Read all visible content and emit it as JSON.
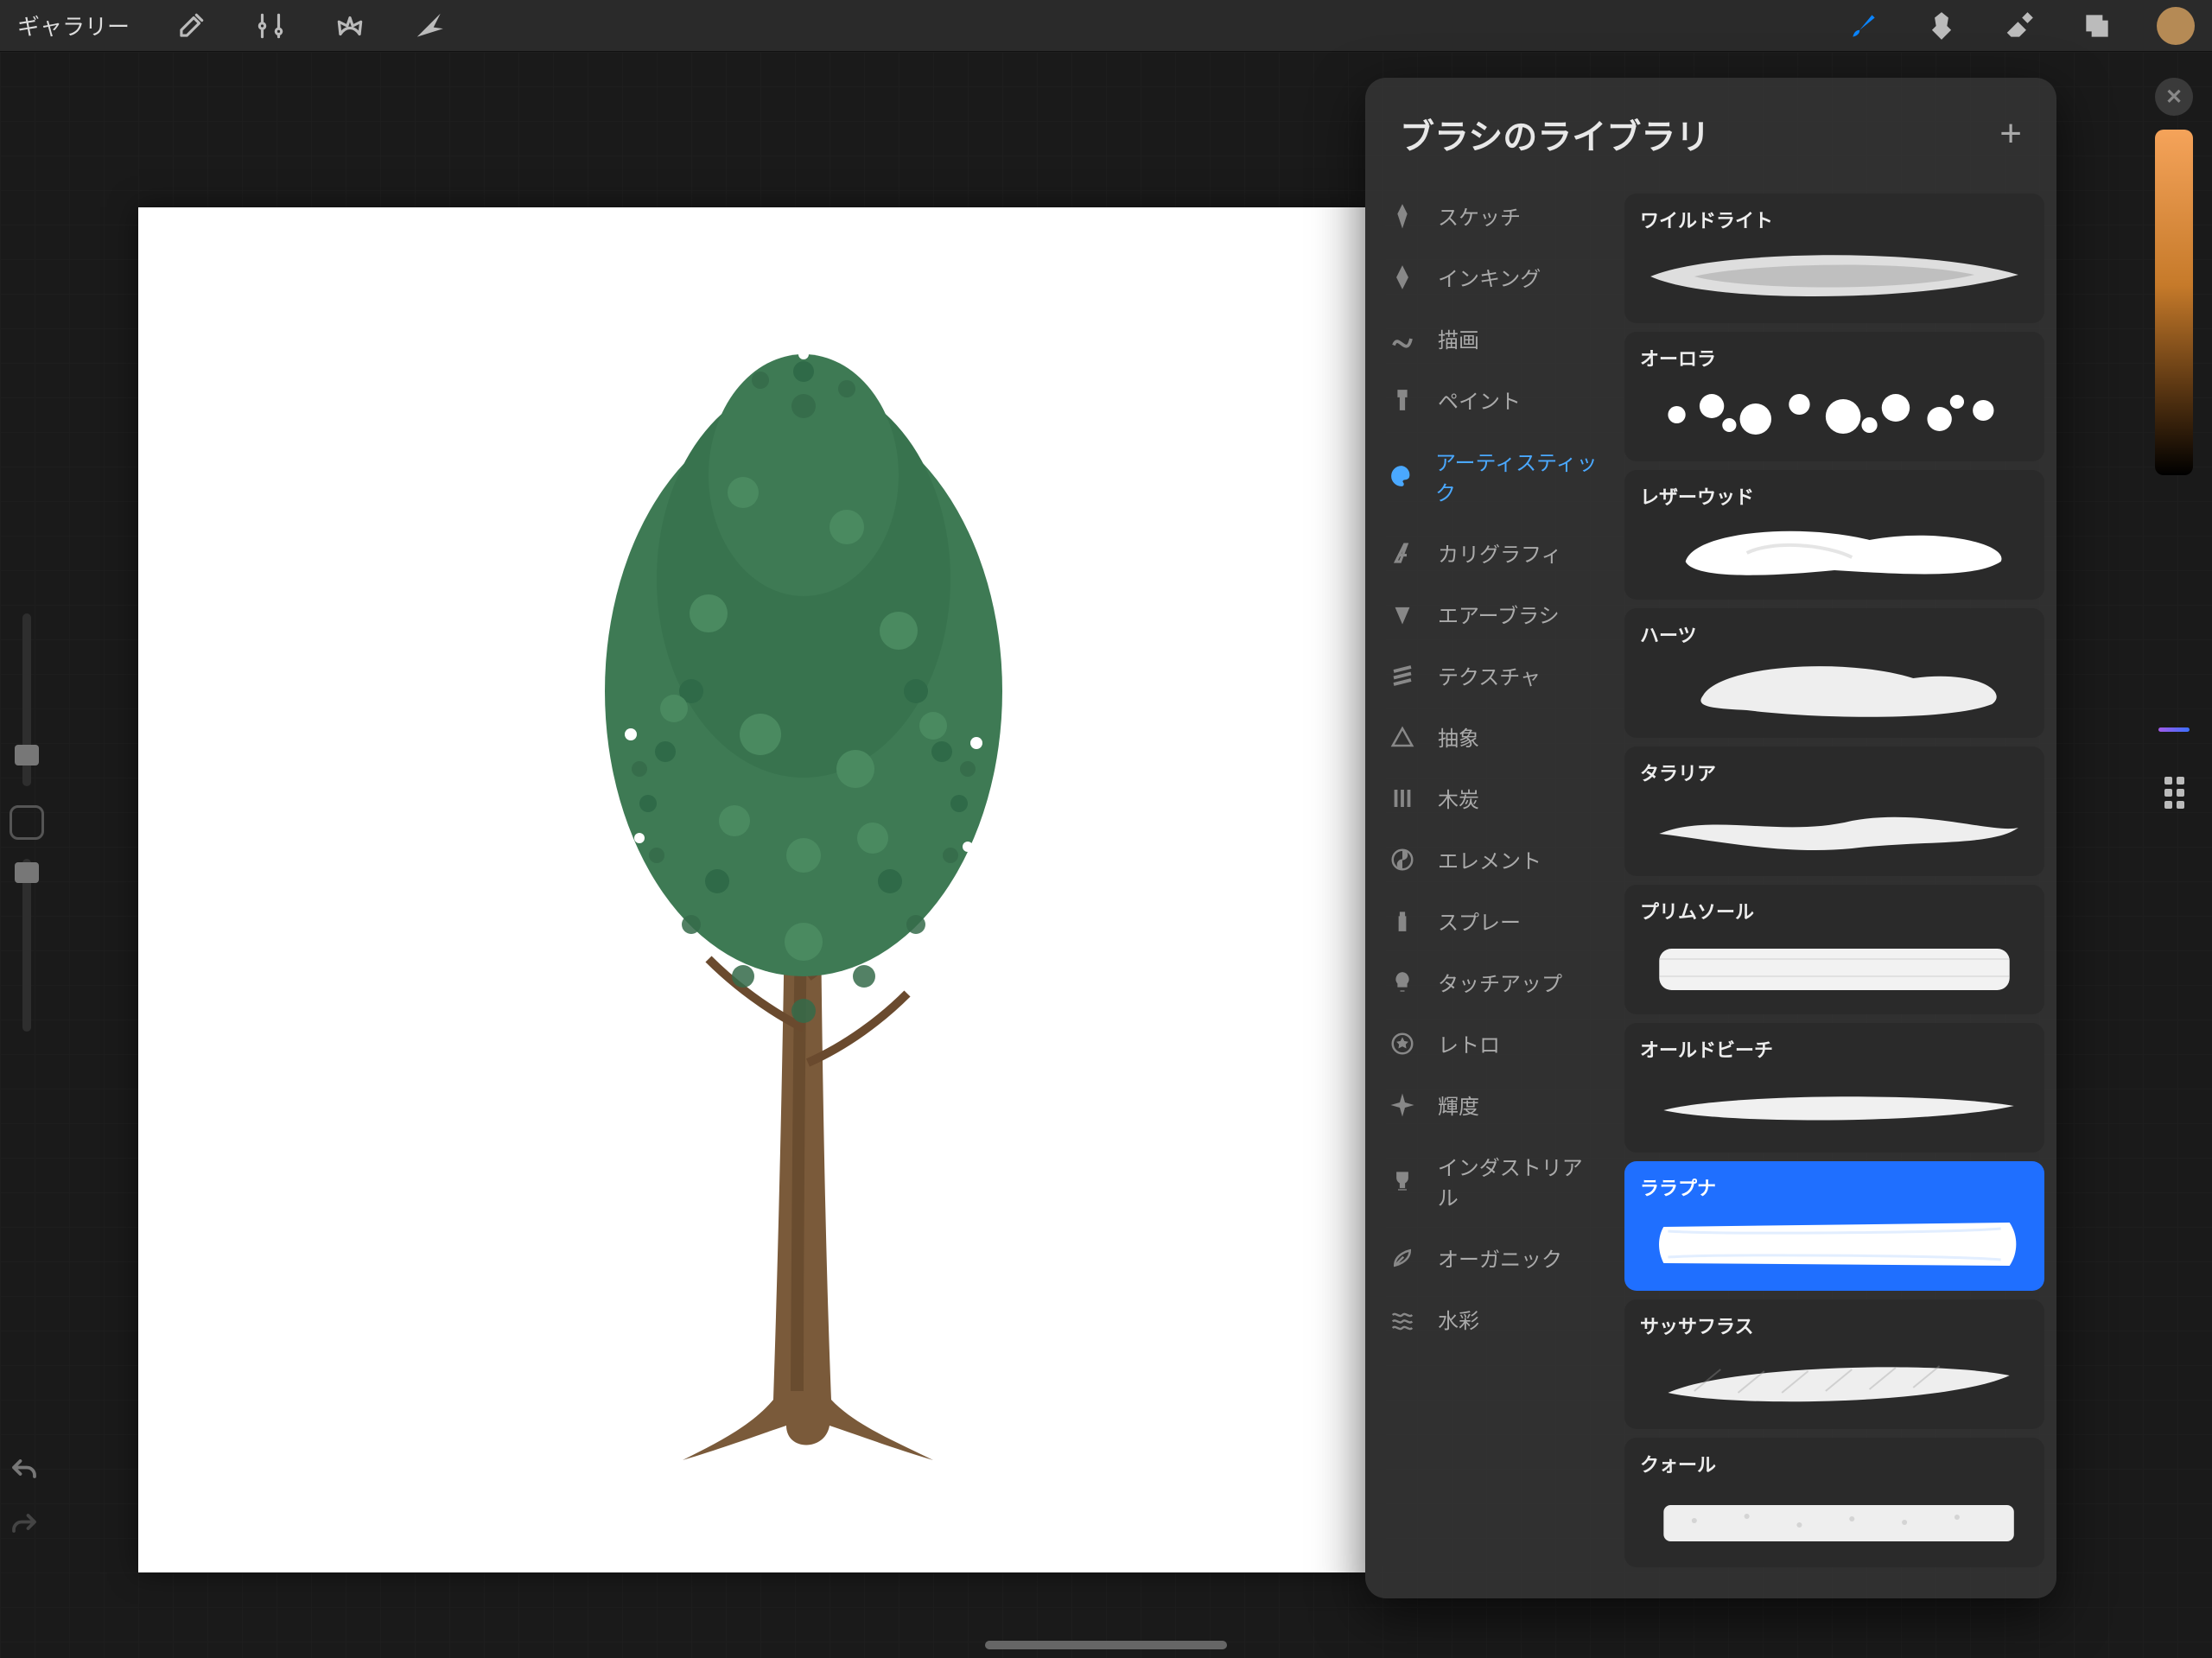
{
  "toolbar": {
    "gallery": "ギャラリー"
  },
  "colors": {
    "swatch": "#b58a55",
    "gradient_top": "#f5a35a",
    "gradient_bottom": "#000000"
  },
  "brush_library": {
    "title": "ブラシのライブラリ",
    "add": "+",
    "categories": [
      {
        "icon": "pen-nib",
        "label": "スケッチ"
      },
      {
        "icon": "fountain",
        "label": "インキング"
      },
      {
        "icon": "squiggle",
        "label": "描画"
      },
      {
        "icon": "brush-flat",
        "label": "ペイント"
      },
      {
        "icon": "palette",
        "label": "アーティスティック",
        "selected": true
      },
      {
        "icon": "italic-a",
        "label": "カリグラフィ"
      },
      {
        "icon": "spray-cone",
        "label": "エアーブラシ"
      },
      {
        "icon": "hatch",
        "label": "テクスチャ"
      },
      {
        "icon": "triangle",
        "label": "抽象"
      },
      {
        "icon": "bars",
        "label": "木炭"
      },
      {
        "icon": "yinyang",
        "label": "エレメント"
      },
      {
        "icon": "spray-can",
        "label": "スプレー"
      },
      {
        "icon": "lightbulb",
        "label": "タッチアップ"
      },
      {
        "icon": "star-circle",
        "label": "レトロ"
      },
      {
        "icon": "sparkle",
        "label": "輝度"
      },
      {
        "icon": "trophy",
        "label": "インダストリアル"
      },
      {
        "icon": "leaf",
        "label": "オーガニック"
      },
      {
        "icon": "waves",
        "label": "水彩"
      }
    ],
    "brushes": [
      {
        "name": "ワイルドライト"
      },
      {
        "name": "オーロラ"
      },
      {
        "name": "レザーウッド"
      },
      {
        "name": "ハーツ"
      },
      {
        "name": "タラリア"
      },
      {
        "name": "プリムソール"
      },
      {
        "name": "オールドビーチ"
      },
      {
        "name": "ララプナ",
        "selected": true
      },
      {
        "name": "サッサフラス"
      },
      {
        "name": "クォール"
      }
    ]
  }
}
